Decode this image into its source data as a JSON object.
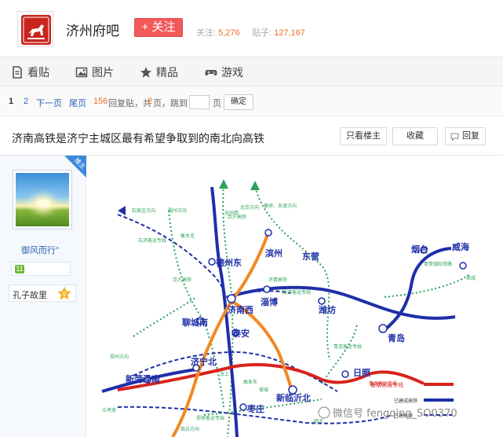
{
  "header": {
    "forum_name": "济州府吧",
    "follow_label": "+ 关注",
    "follow_count_label": "关注:",
    "follow_count": "5,276",
    "post_count_label": "贴子:",
    "post_count": "127,167"
  },
  "tabs": [
    {
      "label": "看贴",
      "icon": "document-icon"
    },
    {
      "label": "图片",
      "icon": "picture-icon"
    },
    {
      "label": "精品",
      "icon": "star-icon"
    },
    {
      "label": "游戏",
      "icon": "gamepad-icon"
    }
  ],
  "pager": {
    "page1": "1",
    "page2": "2",
    "next": "下一页",
    "last": "尾页",
    "reply_count": "156",
    "reply_text": "回复贴，共",
    "page_total": "2",
    "page_total_suffix": "页，跳到",
    "page_unit": "页",
    "confirm": "确定"
  },
  "post": {
    "title": "济南高铁是济宁主城区最有希望争取到的南北向高铁",
    "only_author": "只看楼主",
    "favorite": "收藏",
    "reply": "回复"
  },
  "author": {
    "badge": "楼主",
    "name": "御风而行°",
    "level": "11",
    "member_title": "孔子故里",
    "member_level": "9"
  },
  "map": {
    "cities": [
      "德州东",
      "滨州",
      "东营",
      "烟台",
      "威海",
      "淄博",
      "济南西",
      "潍坊",
      "青岛",
      "聊城南",
      "泰安",
      "济宁北",
      "新菏泽南",
      "新临沂北",
      "日照",
      "枣庄"
    ],
    "small_labels": [
      "霸州方向",
      "京沪高铁",
      "北京方向",
      "黄骅、天津方向",
      "石家庄方向",
      "石济客运专线",
      "衡水北",
      "沧州西",
      "京九高铁",
      "济青高铁",
      "胶济客运专线",
      "青连客运专线",
      "鲁南客运专线",
      "郑徐客运专线",
      "郑州方向",
      "商丘方向",
      "兰考南",
      "荣成",
      "青荣城际铁路",
      "汶上",
      "曲阜东",
      "邹城",
      "临沂",
      "已建成高铁",
      "已建高铁"
    ],
    "legend": [
      "鲁南客运专线",
      "已建成高铁",
      "已建高铁"
    ],
    "watermark": "微信号 fengqing_SO0370"
  },
  "colors": {
    "accent": "#f25a5a",
    "link": "#2d64b3",
    "number": "#f26b2a",
    "rail_blue": "#1f2fa8",
    "rail_orange": "#f08a24",
    "rail_red": "#d8231c",
    "rail_green": "#2ea05a"
  }
}
